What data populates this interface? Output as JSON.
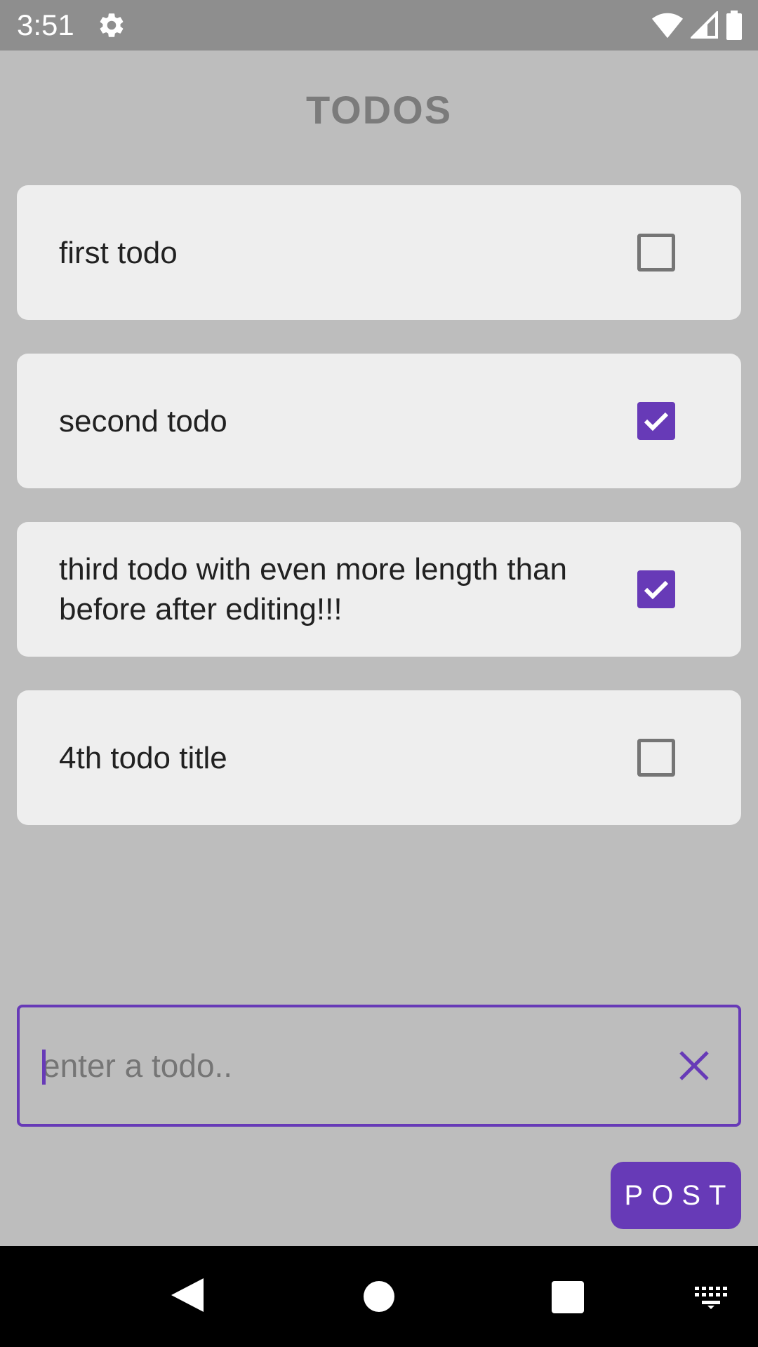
{
  "status_bar": {
    "time": "3:51",
    "icons": [
      "gear-icon",
      "wifi-icon",
      "signal-icon",
      "battery-icon"
    ],
    "background": "#8e8e8e"
  },
  "app": {
    "title": "TODOS",
    "accent_color": "#673ab7"
  },
  "todos": [
    {
      "title": "first todo",
      "checked": false
    },
    {
      "title": "second todo",
      "checked": true
    },
    {
      "title": "third todo with even more length than before after editing!!!",
      "checked": true
    },
    {
      "title": "4th todo title",
      "checked": false
    }
  ],
  "input": {
    "value": "",
    "placeholder": "enter a todo..",
    "clear_icon": "close-icon"
  },
  "post_button": {
    "label": "POST"
  },
  "nav_bar": {
    "icons": [
      "back-icon",
      "home-icon",
      "recents-icon",
      "keyboard-icon"
    ]
  }
}
